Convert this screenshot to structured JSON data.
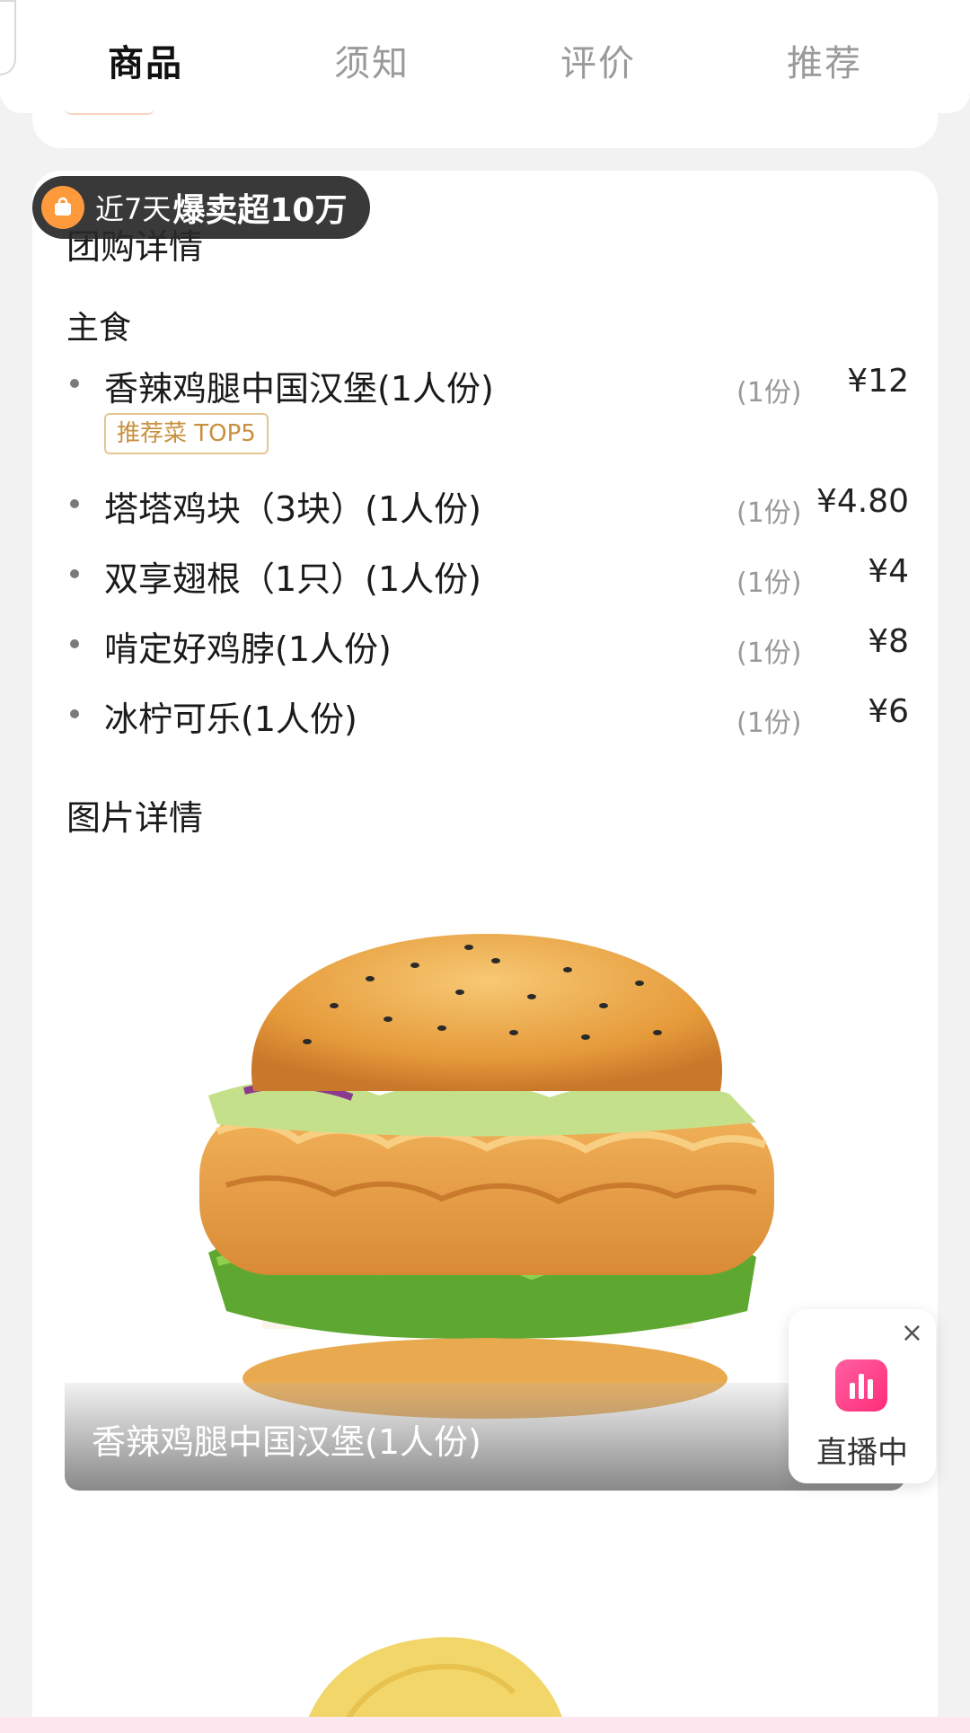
{
  "tabs": [
    {
      "label": "商品",
      "active": true
    },
    {
      "label": "须知",
      "active": false
    },
    {
      "label": "评价",
      "active": false
    },
    {
      "label": "推荐",
      "active": false
    }
  ],
  "sales_badge": {
    "prefix": "近7天",
    "highlight": "爆卖超10万"
  },
  "details": {
    "section_title": "团购详情",
    "group_title": "主食",
    "items": [
      {
        "name": "香辣鸡腿中国汉堡(1人份)",
        "qty": "(1份)",
        "price": "¥12",
        "tag": "推荐菜 TOP5"
      },
      {
        "name": "塔塔鸡块（3块）(1人份)",
        "qty": "(1份)",
        "price": "¥4.80"
      },
      {
        "name": "双享翅根（1只）(1人份)",
        "qty": "(1份)",
        "price": "¥4"
      },
      {
        "name": "啃定好鸡脖(1人份)",
        "qty": "(1份)",
        "price": "¥8"
      },
      {
        "name": "冰柠可乐(1人份)",
        "qty": "(1份)",
        "price": "¥6"
      }
    ]
  },
  "photos": {
    "section_title": "图片详情",
    "caption": "香辣鸡腿中国汉堡(1人份)"
  },
  "live": {
    "label": "直播中",
    "close": "×"
  },
  "colors": {
    "accent_orange": "#ff9a3c",
    "tag_gold": "#c8903e",
    "live_pink": "#ff2d79"
  }
}
